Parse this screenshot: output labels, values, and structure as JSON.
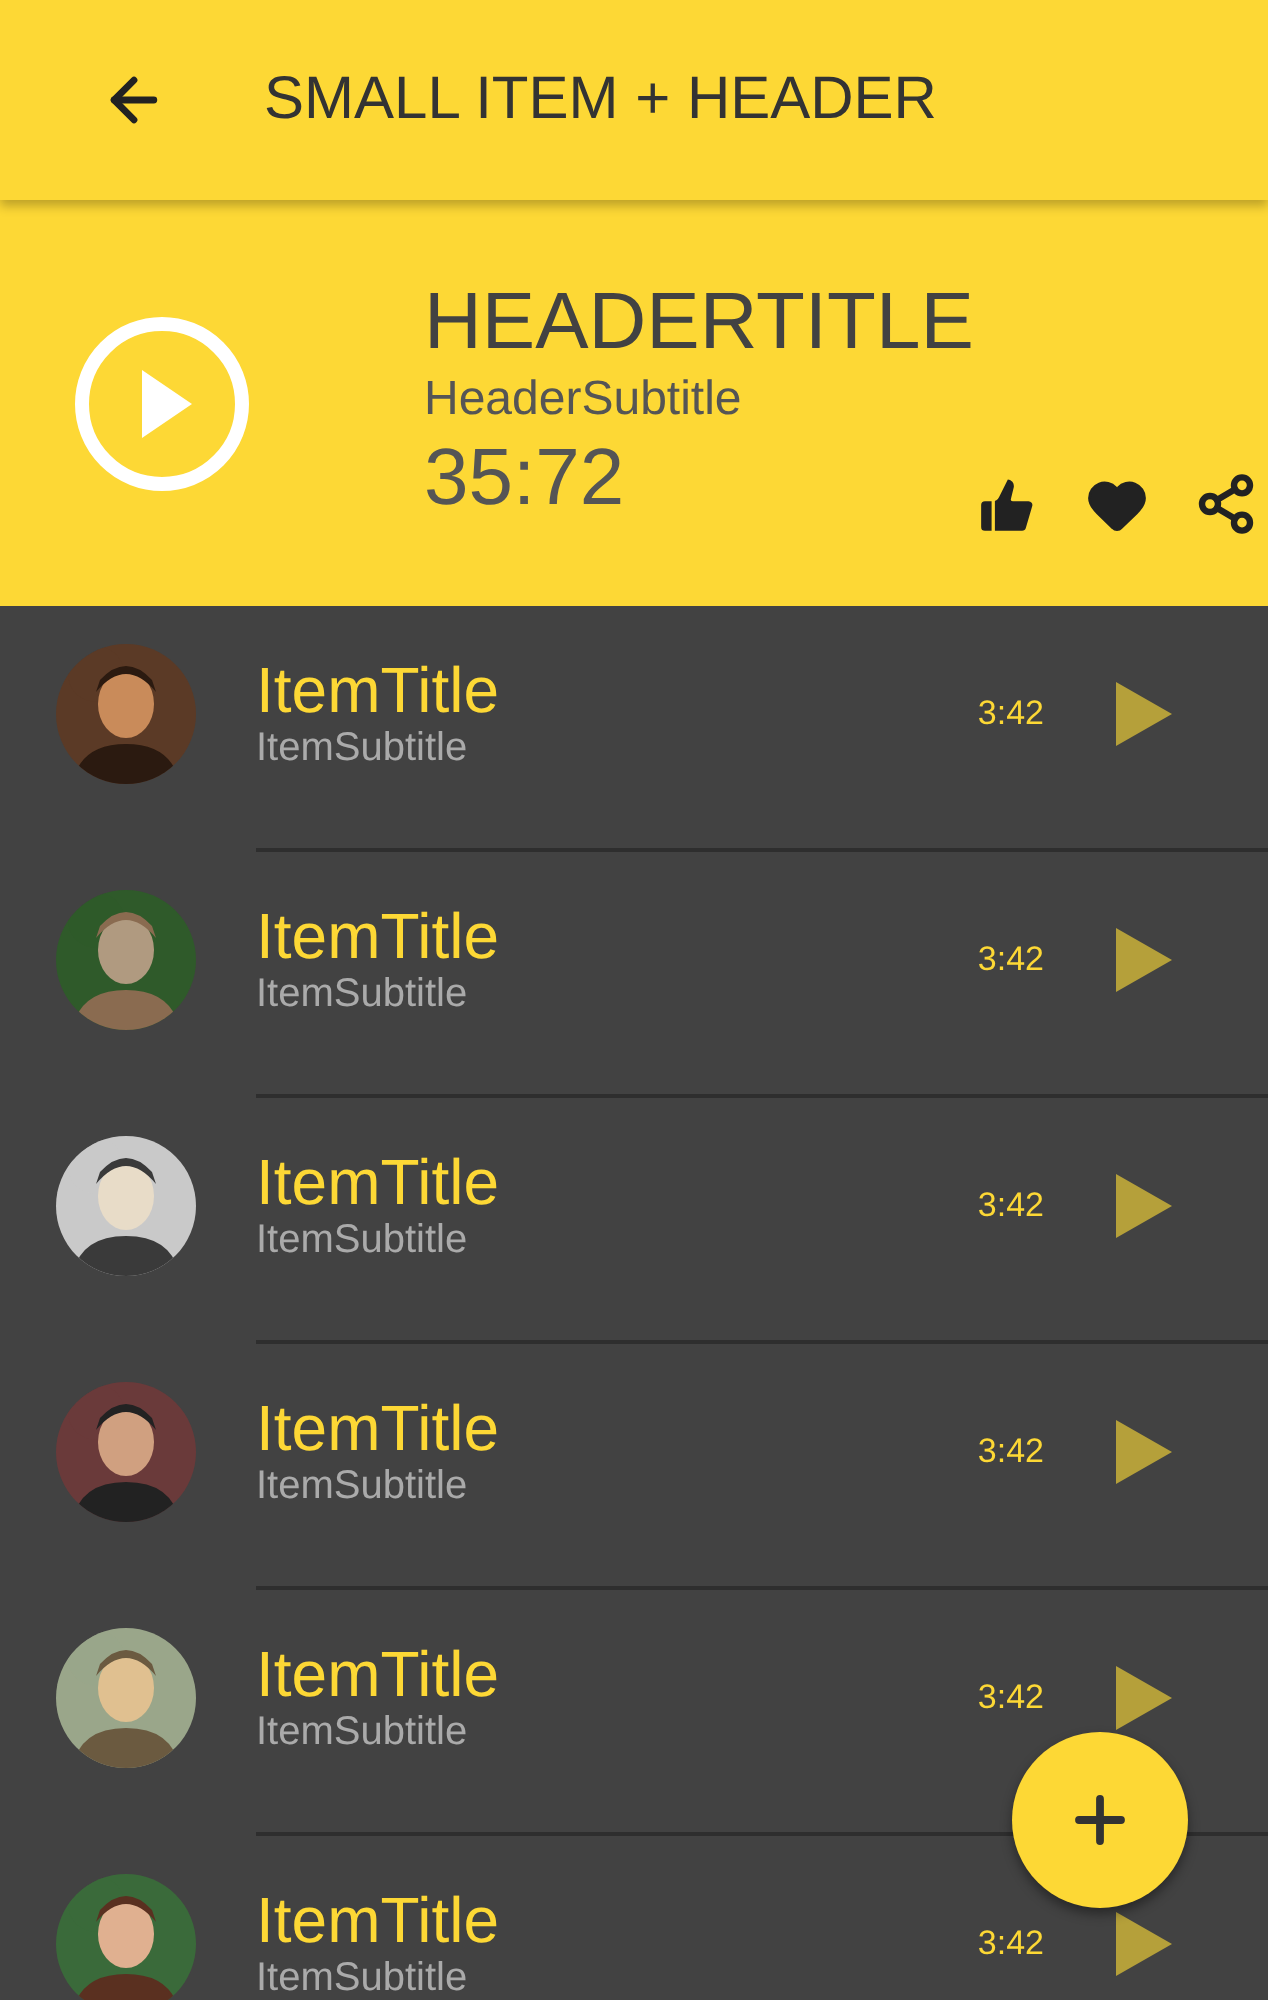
{
  "app_bar": {
    "title": "SMALL ITEM + HEADER"
  },
  "header": {
    "title": "HEADERTITLE",
    "subtitle": "HeaderSubtitle",
    "duration": "35:72"
  },
  "items": [
    {
      "title": "ItemTitle",
      "subtitle": "ItemSubtitle",
      "time": "3:42"
    },
    {
      "title": "ItemTitle",
      "subtitle": "ItemSubtitle",
      "time": "3:42"
    },
    {
      "title": "ItemTitle",
      "subtitle": "ItemSubtitle",
      "time": "3:42"
    },
    {
      "title": "ItemTitle",
      "subtitle": "ItemSubtitle",
      "time": "3:42"
    },
    {
      "title": "ItemTitle",
      "subtitle": "ItemSubtitle",
      "time": "3:42"
    },
    {
      "title": "ItemTitle",
      "subtitle": "ItemSubtitle",
      "time": "3:42"
    }
  ]
}
